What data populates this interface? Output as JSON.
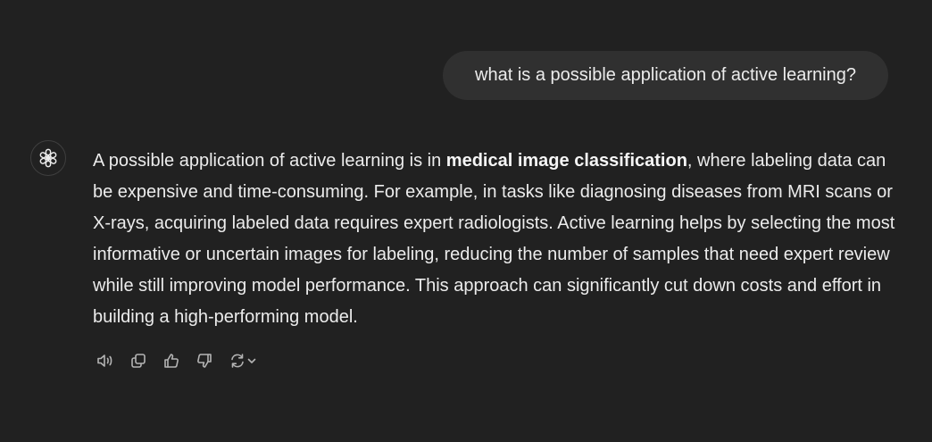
{
  "user_message": {
    "text": "what is a possible application of active learning?"
  },
  "assistant": {
    "avatar_icon": "openai-logo-icon",
    "response": {
      "intro": "A possible application of active learning is in ",
      "bold": "medical image classification",
      "rest": ", where labeling data can be expensive and time-consuming. For example, in tasks like diagnosing diseases from MRI scans or X-rays, acquiring labeled data requires expert radiologists. Active learning helps by selecting the most informative or uncertain images for labeling, reducing the number of samples that need expert review while still improving model performance. This approach can significantly cut down costs and effort in building a high-performing model."
    },
    "actions": [
      {
        "icon": "read-aloud-icon"
      },
      {
        "icon": "copy-icon"
      },
      {
        "icon": "thumbs-up-icon"
      },
      {
        "icon": "thumbs-down-icon"
      },
      {
        "icon": "regenerate-icon"
      }
    ]
  },
  "colors": {
    "background": "#212121",
    "user_bubble": "#303030",
    "text": "#ececec",
    "icon": "#b4b4b4"
  }
}
